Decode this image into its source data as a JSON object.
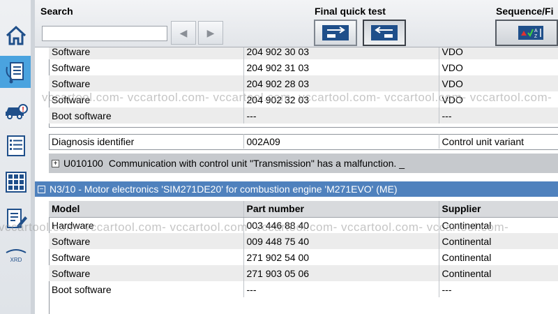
{
  "toolbar": {
    "search_label": "Search",
    "search_value": "",
    "back_label": "◀",
    "forward_label": "▶",
    "quick_test_label": "Final quick test",
    "sequence_label": "Sequence/Fi"
  },
  "sidebar": {
    "items": [
      {
        "icon": "home-icon"
      },
      {
        "icon": "diagnosis-icon"
      },
      {
        "icon": "vehicle-icon"
      },
      {
        "icon": "list-icon"
      },
      {
        "icon": "control-units-icon"
      },
      {
        "icon": "edit-document-icon"
      },
      {
        "icon": "xrd-icon",
        "label": "XRD"
      }
    ]
  },
  "upper_table": {
    "rows": [
      {
        "model": "Software",
        "part": "204 902 30 03",
        "supplier": "VDO"
      },
      {
        "model": "Software",
        "part": "204 902 31 03",
        "supplier": "VDO"
      },
      {
        "model": "Software",
        "part": "204 902 28 03",
        "supplier": "VDO"
      },
      {
        "model": "Software",
        "part": "204 902 32 03",
        "supplier": "VDO"
      },
      {
        "model": "Boot software",
        "part": "---",
        "supplier": "---"
      }
    ]
  },
  "diagnosis": {
    "label": "Diagnosis identifier",
    "value": "002A09",
    "variant": "Control unit variant"
  },
  "fault": {
    "expand": "+",
    "code": "U010100",
    "text": "Communication with control unit \"Transmission\" has a malfunction. _"
  },
  "section": {
    "expand": "−",
    "title": "N3/10 - Motor electronics 'SIM271DE20' for combustion engine 'M271EVO' (ME)"
  },
  "lower_table": {
    "headers": [
      "Model",
      "Part number",
      "Supplier"
    ],
    "rows": [
      {
        "model": "Hardware",
        "part": "003 446 88 40",
        "supplier": "Continental"
      },
      {
        "model": "Software",
        "part": "009 448 75 40",
        "supplier": "Continental"
      },
      {
        "model": "Software",
        "part": "271 902 54 00",
        "supplier": "Continental"
      },
      {
        "model": "Software",
        "part": "271 903 05 06",
        "supplier": "Continental"
      },
      {
        "model": "Boot software",
        "part": "---",
        "supplier": "---"
      }
    ]
  },
  "watermarks": {
    "line1": "vccartool.com- vccartool.com- vccartool.com- vccartool.com- vccartool.com- vccartool.com-",
    "line2": "vccartool.com- vccartool.com- vccartool.com- vccartool.com- vccartool.com- vccartool.com-"
  },
  "colors": {
    "section_header": "#4f81bd",
    "active_sidebar": "#4aa3df",
    "fault_row": "#c6c9cd"
  }
}
